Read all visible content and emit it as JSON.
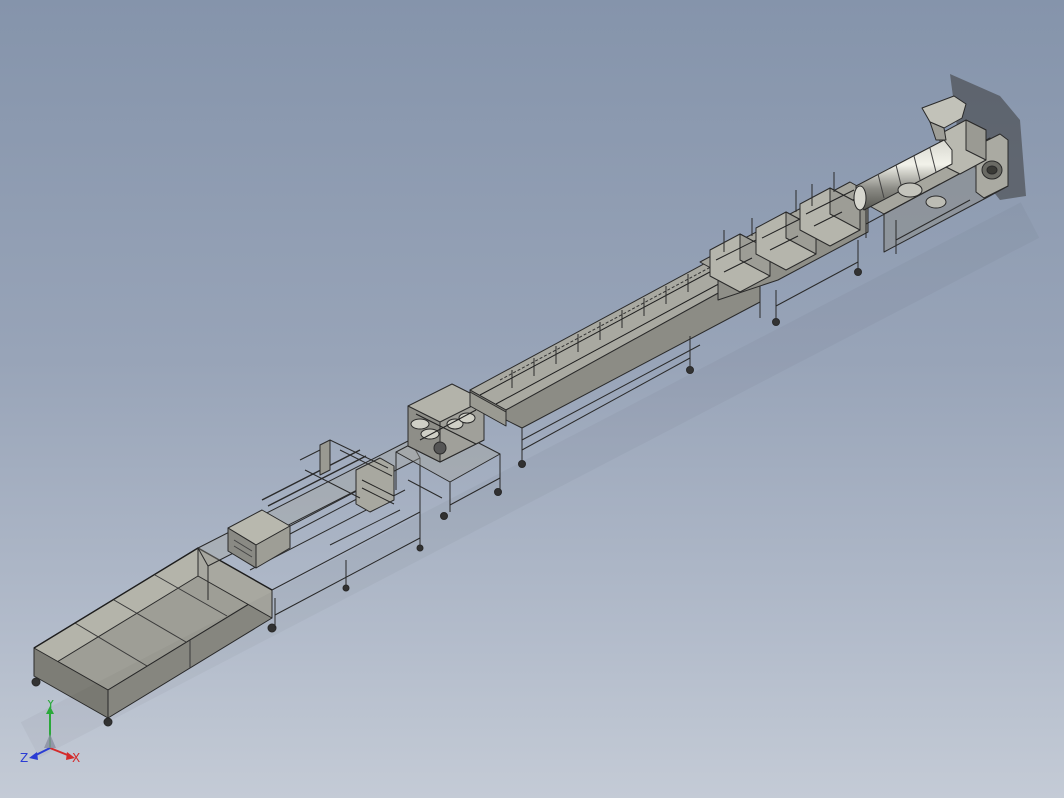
{
  "view": {
    "background_top": "#8594ab",
    "background_bottom": "#c4cbd6",
    "part_fill": "#9b9b92",
    "part_fill_light": "#b8b8ae",
    "part_fill_dark": "#6f6f68",
    "line_color": "#2a2a2a"
  },
  "triad": {
    "x_label": "X",
    "y_label": "Y",
    "z_label": "Z",
    "x_color": "#d42a2a",
    "y_color": "#2aa83a",
    "z_color": "#2a3cd4"
  },
  "equipment": [
    {
      "name": "collection-tank"
    },
    {
      "name": "cutter-unit"
    },
    {
      "name": "haul-off-unit"
    },
    {
      "name": "cooling-tank"
    },
    {
      "name": "calibration-units"
    },
    {
      "name": "extruder"
    }
  ]
}
